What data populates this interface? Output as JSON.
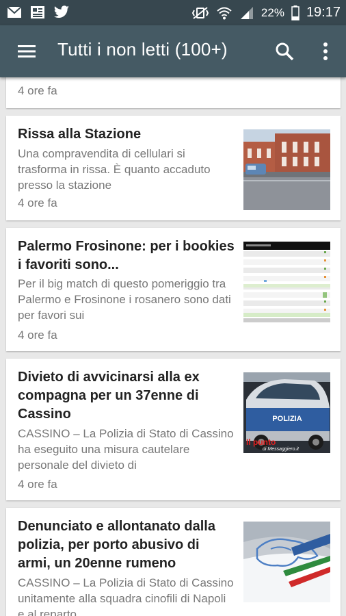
{
  "status_bar": {
    "battery_percent": "22%",
    "time": "19:17"
  },
  "app_bar": {
    "title": "Tutti i non letti (100+)"
  },
  "articles": [
    {
      "time": "4 ore fa"
    },
    {
      "title": "Rissa alla Stazione",
      "excerpt": "Una compravendita di cellulari si trasforma in rissa.   È quanto accaduto presso la stazione",
      "time": "4 ore fa"
    },
    {
      "title": "Palermo Frosinone: per i bookies i favoriti sono...",
      "excerpt": "Per il big match di questo pomeriggio tra Palermo e Frosinone i rosanero sono dati per favori sui",
      "time": "4 ore fa"
    },
    {
      "title": "Divieto di avvicinarsi alla ex compagna per un 37enne di Cassino",
      "excerpt": "CASSINO – La Polizia di Stato di Cassino ha eseguito una misura cautelare personale del divieto di",
      "time": "4 ore fa",
      "thumb_text": "POLIZIA",
      "thumb_watermark_1": "Il punto",
      "thumb_watermark_2": "di Messaggiero.it"
    },
    {
      "title": "Denunciato e allontanato dalla polizia, per porto abusivo di armi, un 20enne rumeno",
      "excerpt": "CASSINO – La Polizia di Stato di Cassino unitamente alla squadra cinofili di Napoli e al reparto"
    }
  ],
  "colors": {
    "status_bar": "#37474f",
    "app_bar": "#455a64",
    "background": "#e8e8e8"
  }
}
